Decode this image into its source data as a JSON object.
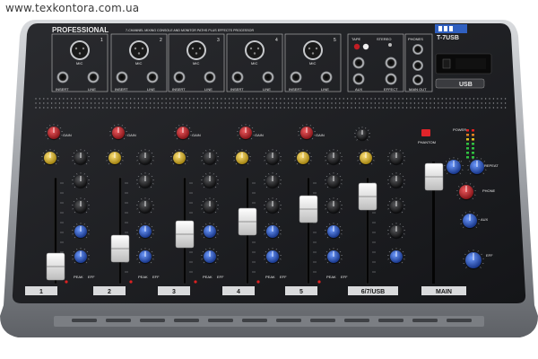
{
  "watermark": "www.texkontora.com.ua",
  "brand": "PROFESSIONAL",
  "tagline": "7-CHANNEL MIXING CONSOLE AND MONITOR PATHS PLUS EFFECTS PROCESSOR",
  "model": "T-7USB",
  "usb_label": "USB",
  "channels": [
    {
      "number": "1",
      "strip_label": "1"
    },
    {
      "number": "2",
      "strip_label": "2"
    },
    {
      "number": "3",
      "strip_label": "3"
    },
    {
      "number": "4",
      "strip_label": "4"
    },
    {
      "number": "5",
      "strip_label": "5"
    }
  ],
  "input_labels": {
    "mic": "MIC",
    "insert": "INSERT",
    "line": "LINE"
  },
  "stereo_section": {
    "tape_label": "TAPE",
    "stereo_label": "STEREO",
    "phones_label": "PHONES",
    "aux_label": "AUX",
    "effect_label": "EFFECT",
    "main_out_label": "MAIN OUT"
  },
  "strip_knob_labels": {
    "gain": "GAIN",
    "peak": "PEAK",
    "eff": "EFF"
  },
  "usb_strip_label": "6/7/USB",
  "main_strip_label": "MAIN",
  "master_labels": {
    "phantom": "PHANTOM",
    "power": "POWER",
    "repeat": "REPEAT",
    "delay": "DELAY",
    "phone": "PHONE",
    "aux": "AUX",
    "eff": "EFF"
  },
  "colors": {
    "panel": "#1c1d20",
    "frame": "#9a9da3",
    "knob_red": "#c0262b",
    "knob_yellow": "#d8b21c",
    "knob_blue": "#2455b8",
    "knob_black": "#141416",
    "fader_cap": "#e9e9e9"
  }
}
